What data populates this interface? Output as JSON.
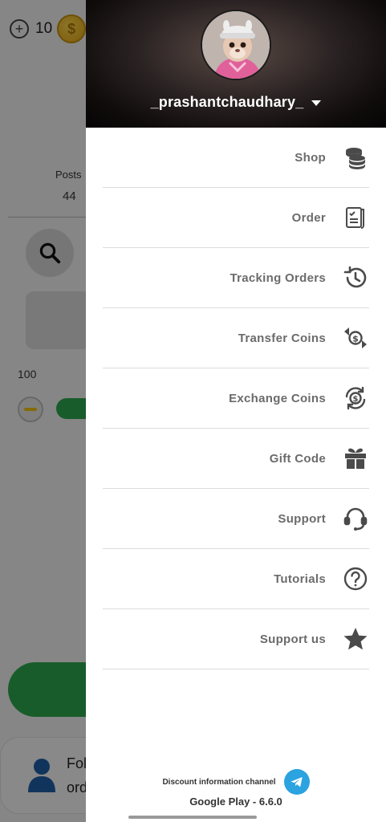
{
  "background": {
    "coin_count": "10",
    "posts_label": "Posts",
    "posts_value": "44",
    "amount": "100",
    "follow_text_1": "Fol",
    "follow_text_2": "ord"
  },
  "drawer": {
    "username": "_prashantchaudhary_",
    "menu": [
      {
        "label": "Shop",
        "icon": "coins-stack-icon"
      },
      {
        "label": "Order",
        "icon": "order-receipt-icon"
      },
      {
        "label": "Tracking Orders",
        "icon": "history-icon"
      },
      {
        "label": "Transfer Coins",
        "icon": "transfer-coins-icon"
      },
      {
        "label": "Exchange Coins",
        "icon": "exchange-coins-icon"
      },
      {
        "label": "Gift Code",
        "icon": "gift-icon"
      },
      {
        "label": "Support",
        "icon": "headset-icon"
      },
      {
        "label": "Tutorials",
        "icon": "question-icon"
      },
      {
        "label": "Support us",
        "icon": "star-icon"
      }
    ],
    "channel_text": "Discount information channel",
    "version": "Google Play - 6.6.0"
  },
  "colors": {
    "accent_green": "#2fa84f",
    "telegram_blue": "#2aa3e0",
    "menu_text": "#6b6b6b",
    "icon": "#4a4a4a"
  }
}
